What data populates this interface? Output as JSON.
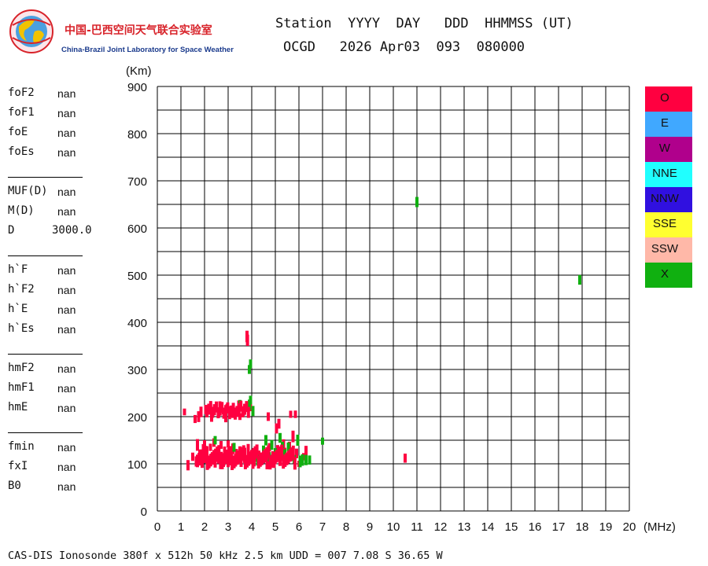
{
  "logo": {
    "name_zh": "中国-巴西空间天气联合实验室",
    "name_en": "China-Brazil Joint Laboratory for Space Weather"
  },
  "header": {
    "line1": "Station  YYYY  DAY   DDD  HHMMSS (UT)",
    "line2": "OCGD   2026 Apr03  093  080000"
  },
  "params": [
    {
      "label": "foF2",
      "value": "nan"
    },
    {
      "label": "foF1",
      "value": "nan"
    },
    {
      "label": "foE",
      "value": "nan"
    },
    {
      "label": "foEs",
      "value": "nan"
    },
    {
      "label": "MUF(D)",
      "value": "nan"
    },
    {
      "label": "M(D)",
      "value": "nan"
    },
    {
      "label": "D",
      "value": "3000.0"
    },
    {
      "label": "h`F",
      "value": "nan"
    },
    {
      "label": "h`F2",
      "value": "nan"
    },
    {
      "label": "h`E",
      "value": "nan"
    },
    {
      "label": "h`Es",
      "value": "nan"
    },
    {
      "label": "hmF2",
      "value": "nan"
    },
    {
      "label": "hmF1",
      "value": "nan"
    },
    {
      "label": "hmE",
      "value": "nan"
    },
    {
      "label": "fmin",
      "value": "nan"
    },
    {
      "label": "fxI",
      "value": "nan"
    },
    {
      "label": "B0",
      "value": "nan"
    }
  ],
  "footer": "CAS-DIS Ionosonde 380f x 512h 50 kHz 2.5 km UDD = 007 7.08 S 36.65 W",
  "legend": [
    {
      "label": "O",
      "color": "#ff0040"
    },
    {
      "label": "E",
      "color": "#40a8ff"
    },
    {
      "label": "W",
      "color": "#b0008c"
    },
    {
      "label": "NNE",
      "color": "#20ffff"
    },
    {
      "label": "NNW",
      "color": "#3010e0"
    },
    {
      "label": "SSE",
      "color": "#ffff30"
    },
    {
      "label": "SSW",
      "color": "#ffb8a8"
    },
    {
      "label": "X",
      "color": "#10b010"
    }
  ],
  "chart_data": {
    "type": "scatter",
    "ylabel": "(Km)",
    "xlabel": "(MHz)",
    "xlim": [
      0,
      20
    ],
    "ylim": [
      0,
      900
    ],
    "x_ticks": [
      0,
      1,
      2,
      3,
      4,
      5,
      6,
      7,
      8,
      9,
      10,
      11,
      12,
      13,
      14,
      15,
      16,
      17,
      18,
      19,
      20
    ],
    "y_ticks": [
      0,
      100,
      200,
      300,
      400,
      500,
      600,
      700,
      800,
      900
    ],
    "grid": true,
    "legend_position": "right",
    "series": [
      {
        "name": "O",
        "color": "#ff0040",
        "points": [
          [
            1.15,
            210
          ],
          [
            1.3,
            97
          ],
          [
            1.5,
            115
          ],
          [
            1.6,
            195
          ],
          [
            1.65,
            105
          ],
          [
            1.75,
            200
          ],
          [
            1.8,
            120
          ],
          [
            1.85,
            210
          ],
          [
            1.9,
            100
          ],
          [
            1.95,
            130
          ],
          [
            2.0,
            108
          ],
          [
            2.05,
            215
          ],
          [
            2.1,
            125
          ],
          [
            2.15,
            100
          ],
          [
            2.2,
            220
          ],
          [
            2.25,
            135
          ],
          [
            2.3,
            110
          ],
          [
            2.35,
            210
          ],
          [
            2.4,
            122
          ],
          [
            2.45,
            100
          ],
          [
            2.5,
            218
          ],
          [
            2.55,
            130
          ],
          [
            2.6,
            108
          ],
          [
            2.65,
            225
          ],
          [
            2.7,
            118
          ],
          [
            2.75,
            100
          ],
          [
            2.8,
            212
          ],
          [
            2.85,
            128
          ],
          [
            2.9,
            110
          ],
          [
            2.95,
            220
          ],
          [
            3.0,
            102
          ],
          [
            3.05,
            125
          ],
          [
            3.1,
            215
          ],
          [
            3.15,
            112
          ],
          [
            3.2,
            132
          ],
          [
            3.25,
            100
          ],
          [
            3.3,
            210
          ],
          [
            3.35,
            120
          ],
          [
            3.4,
            108
          ],
          [
            3.45,
            222
          ],
          [
            3.5,
            130
          ],
          [
            3.55,
            102
          ],
          [
            3.6,
            118
          ],
          [
            3.65,
            212
          ],
          [
            3.7,
            125
          ],
          [
            3.75,
            105
          ],
          [
            3.8,
            370
          ],
          [
            3.82,
            362
          ],
          [
            3.85,
            130
          ],
          [
            3.9,
            112
          ],
          [
            3.95,
            220
          ],
          [
            4.0,
            120
          ],
          [
            4.1,
            105
          ],
          [
            4.15,
            128
          ],
          [
            4.2,
            112
          ],
          [
            4.3,
            118
          ],
          [
            4.4,
            105
          ],
          [
            4.5,
            125
          ],
          [
            4.6,
            110
          ],
          [
            4.7,
            200
          ],
          [
            4.75,
            135
          ],
          [
            4.8,
            108
          ],
          [
            4.9,
            120
          ],
          [
            5.0,
            112
          ],
          [
            5.05,
            175
          ],
          [
            5.1,
            130
          ],
          [
            5.15,
            185
          ],
          [
            5.2,
            105
          ],
          [
            5.3,
            118
          ],
          [
            5.35,
            142
          ],
          [
            5.4,
            125
          ],
          [
            5.5,
            110
          ],
          [
            5.6,
            135
          ],
          [
            5.65,
            205
          ],
          [
            5.7,
            118
          ],
          [
            5.75,
            158
          ],
          [
            5.8,
            108
          ],
          [
            5.85,
            205
          ],
          [
            5.9,
            122
          ],
          [
            6.0,
            100
          ],
          [
            6.2,
            115
          ],
          [
            6.3,
            128
          ],
          [
            10.5,
            112
          ],
          [
            2.2,
            105
          ],
          [
            2.5,
            112
          ],
          [
            2.8,
            103
          ],
          [
            3.1,
            108
          ],
          [
            3.4,
            115
          ],
          [
            3.7,
            110
          ],
          [
            4.05,
            100
          ],
          [
            4.35,
            110
          ],
          [
            4.65,
            100
          ],
          [
            4.95,
            103
          ],
          [
            2.3,
            200
          ],
          [
            2.6,
            205
          ],
          [
            2.9,
            200
          ],
          [
            3.2,
            205
          ],
          [
            3.5,
            200
          ],
          [
            1.7,
            140
          ],
          [
            2.0,
            140
          ],
          [
            2.4,
            145
          ],
          [
            2.7,
            140
          ],
          [
            3.0,
            142
          ]
        ]
      },
      {
        "name": "X",
        "color": "#10b010",
        "points": [
          [
            3.9,
            300
          ],
          [
            3.95,
            312
          ],
          [
            3.9,
            225
          ],
          [
            3.95,
            235
          ],
          [
            4.05,
            212
          ],
          [
            4.25,
            108
          ],
          [
            4.5,
            130
          ],
          [
            4.75,
            115
          ],
          [
            4.85,
            140
          ],
          [
            5.0,
            125
          ],
          [
            5.2,
            155
          ],
          [
            5.4,
            120
          ],
          [
            5.55,
            135
          ],
          [
            5.8,
            110
          ],
          [
            5.95,
            150
          ],
          [
            6.05,
            105
          ],
          [
            6.15,
            108
          ],
          [
            6.3,
            108
          ],
          [
            6.45,
            108
          ],
          [
            7.0,
            148
          ],
          [
            11.0,
            655
          ],
          [
            17.9,
            490
          ],
          [
            3.5,
            225
          ],
          [
            2.45,
            150
          ],
          [
            3.25,
            135
          ],
          [
            4.6,
            150
          ],
          [
            5.3,
            140
          ]
        ]
      }
    ]
  }
}
